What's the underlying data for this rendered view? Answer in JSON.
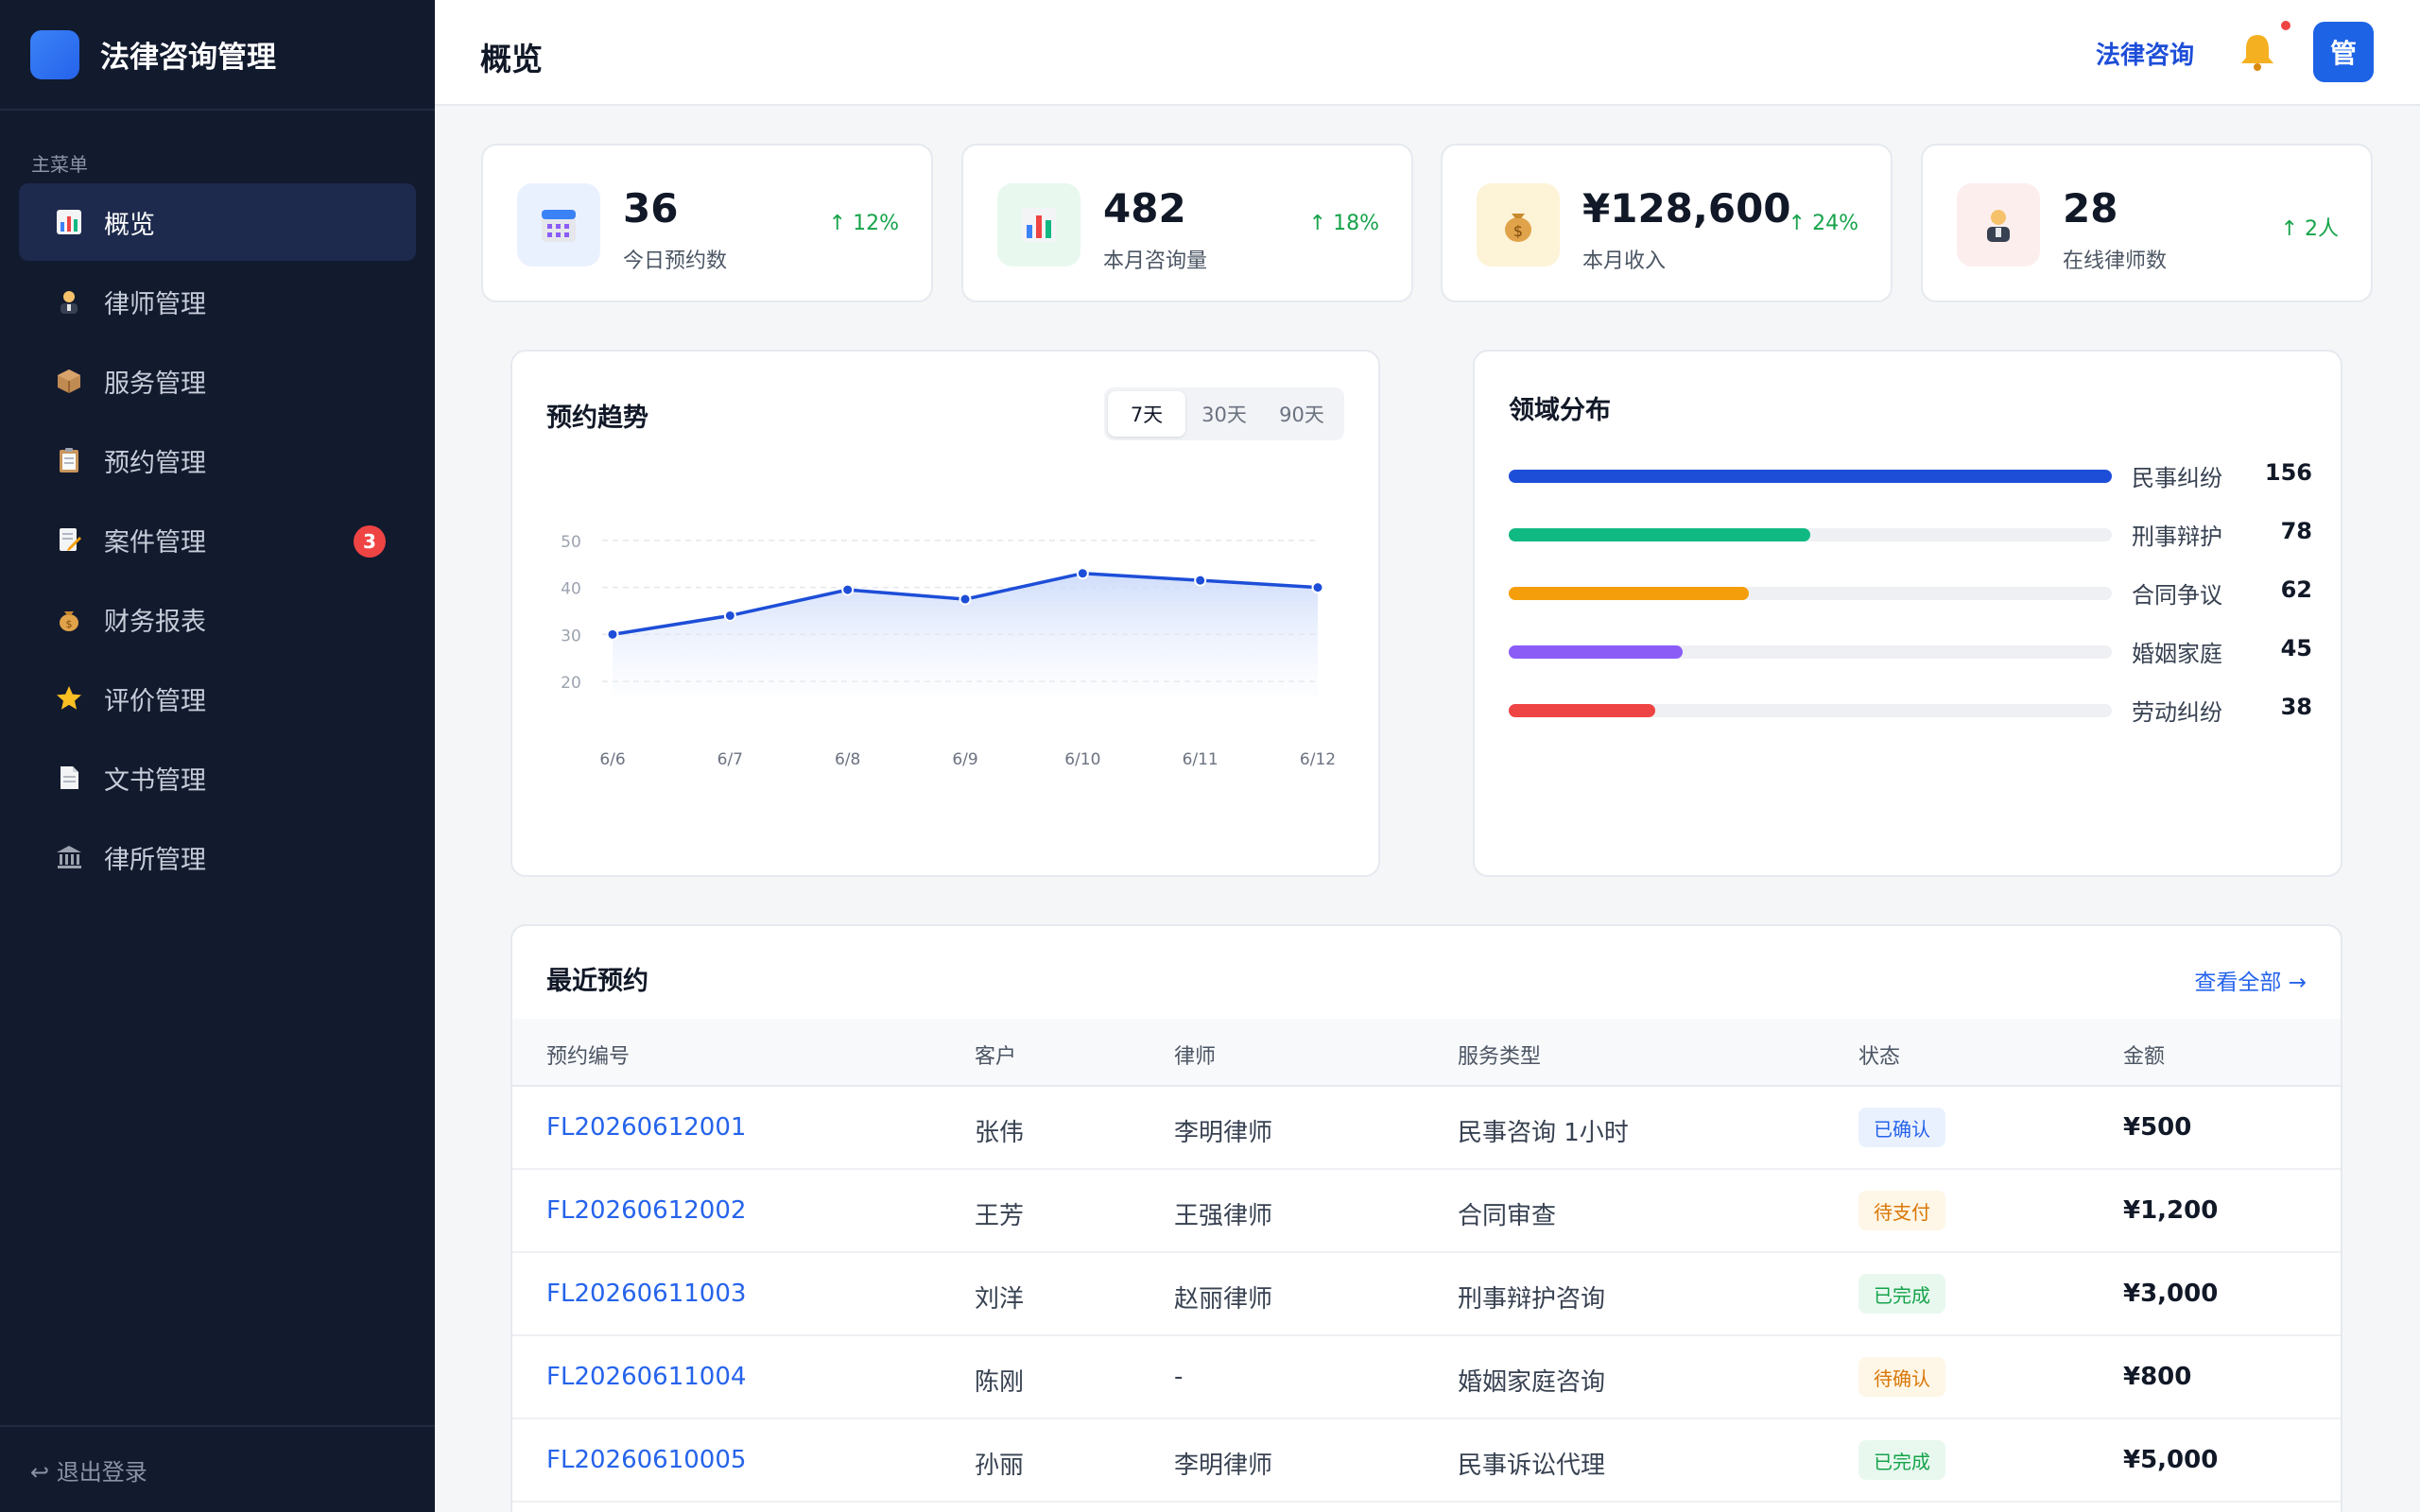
{
  "brand": {
    "title": "法律咨询管理"
  },
  "sidebar": {
    "caption": "主菜单",
    "items": [
      {
        "label": "概览",
        "icon": "chart-icon",
        "active": true
      },
      {
        "label": "律师管理",
        "icon": "lawyer-icon"
      },
      {
        "label": "服务管理",
        "icon": "package-icon"
      },
      {
        "label": "预约管理",
        "icon": "clipboard-icon"
      },
      {
        "label": "案件管理",
        "icon": "memo-icon",
        "badge": "3"
      },
      {
        "label": "财务报表",
        "icon": "money-bag-icon"
      },
      {
        "label": "评价管理",
        "icon": "star-icon"
      },
      {
        "label": "文书管理",
        "icon": "document-icon"
      },
      {
        "label": "律所管理",
        "icon": "bank-icon"
      }
    ],
    "logout": "↩ 退出登录"
  },
  "header": {
    "title": "概览",
    "link": "法律咨询",
    "avatar": "管"
  },
  "stats": [
    {
      "value": "36",
      "label": "今日预约数",
      "trend": "↑ 12%",
      "icon": "calendar-icon"
    },
    {
      "value": "482",
      "label": "本月咨询量",
      "trend": "↑ 18%",
      "icon": "bar-chart-icon"
    },
    {
      "value": "¥128,600",
      "label": "本月收入",
      "trend": "↑ 24%",
      "icon": "money-bag-icon"
    },
    {
      "value": "28",
      "label": "在线律师数",
      "trend": "↑ 2人",
      "icon": "lawyer-icon"
    }
  ],
  "trend": {
    "title": "预约趋势",
    "ranges": [
      "7天",
      "30天",
      "90天"
    ],
    "active_range": "7天"
  },
  "chart_data": {
    "type": "area",
    "title": "预约趋势",
    "categories": [
      "6/6",
      "6/7",
      "6/8",
      "6/9",
      "6/10",
      "6/11",
      "6/12"
    ],
    "values": [
      30,
      34,
      39.5,
      37.5,
      43,
      41.5,
      40
    ],
    "yticks": [
      20,
      30,
      40,
      50
    ],
    "ylim": [
      17,
      54
    ],
    "grid": true,
    "color": "#1d4ed8"
  },
  "distribution": {
    "title": "领域分布",
    "max": 156,
    "items": [
      {
        "name": "民事纠纷",
        "value": 156,
        "color": "#1d4ed8"
      },
      {
        "name": "刑事辩护",
        "value": 78,
        "color": "#10b981"
      },
      {
        "name": "合同争议",
        "value": 62,
        "color": "#f59e0b"
      },
      {
        "name": "婚姻家庭",
        "value": 45,
        "color": "#8b5cf6"
      },
      {
        "name": "劳动纠纷",
        "value": 38,
        "color": "#ef4444"
      }
    ]
  },
  "recent": {
    "title": "最近预约",
    "view_all": "查看全部 →",
    "columns": [
      "预约编号",
      "客户",
      "律师",
      "服务类型",
      "状态",
      "金额"
    ],
    "rows": [
      {
        "id": "FL20260612001",
        "client": "张伟",
        "lawyer": "李明律师",
        "service": "民事咨询 1小时",
        "status": "已确认",
        "status_kind": "confirmed",
        "amount": "¥500"
      },
      {
        "id": "FL20260612002",
        "client": "王芳",
        "lawyer": "王强律师",
        "service": "合同审查",
        "status": "待支付",
        "status_kind": "pending",
        "amount": "¥1,200"
      },
      {
        "id": "FL20260611003",
        "client": "刘洋",
        "lawyer": "赵丽律师",
        "service": "刑事辩护咨询",
        "status": "已完成",
        "status_kind": "done",
        "amount": "¥3,000"
      },
      {
        "id": "FL20260611004",
        "client": "陈刚",
        "lawyer": "-",
        "service": "婚姻家庭咨询",
        "status": "待确认",
        "status_kind": "pending",
        "amount": "¥800"
      },
      {
        "id": "FL20260610005",
        "client": "孙丽",
        "lawyer": "李明律师",
        "service": "民事诉讼代理",
        "status": "已完成",
        "status_kind": "done",
        "amount": "¥5,000"
      }
    ]
  },
  "status_colors": {
    "confirmed": {
      "bg": "#eaf1fe",
      "fg": "#2563eb"
    },
    "pending": {
      "bg": "#fef6e6",
      "fg": "#d97706"
    },
    "done": {
      "bg": "#e8f8ef",
      "fg": "#16a34a"
    }
  }
}
